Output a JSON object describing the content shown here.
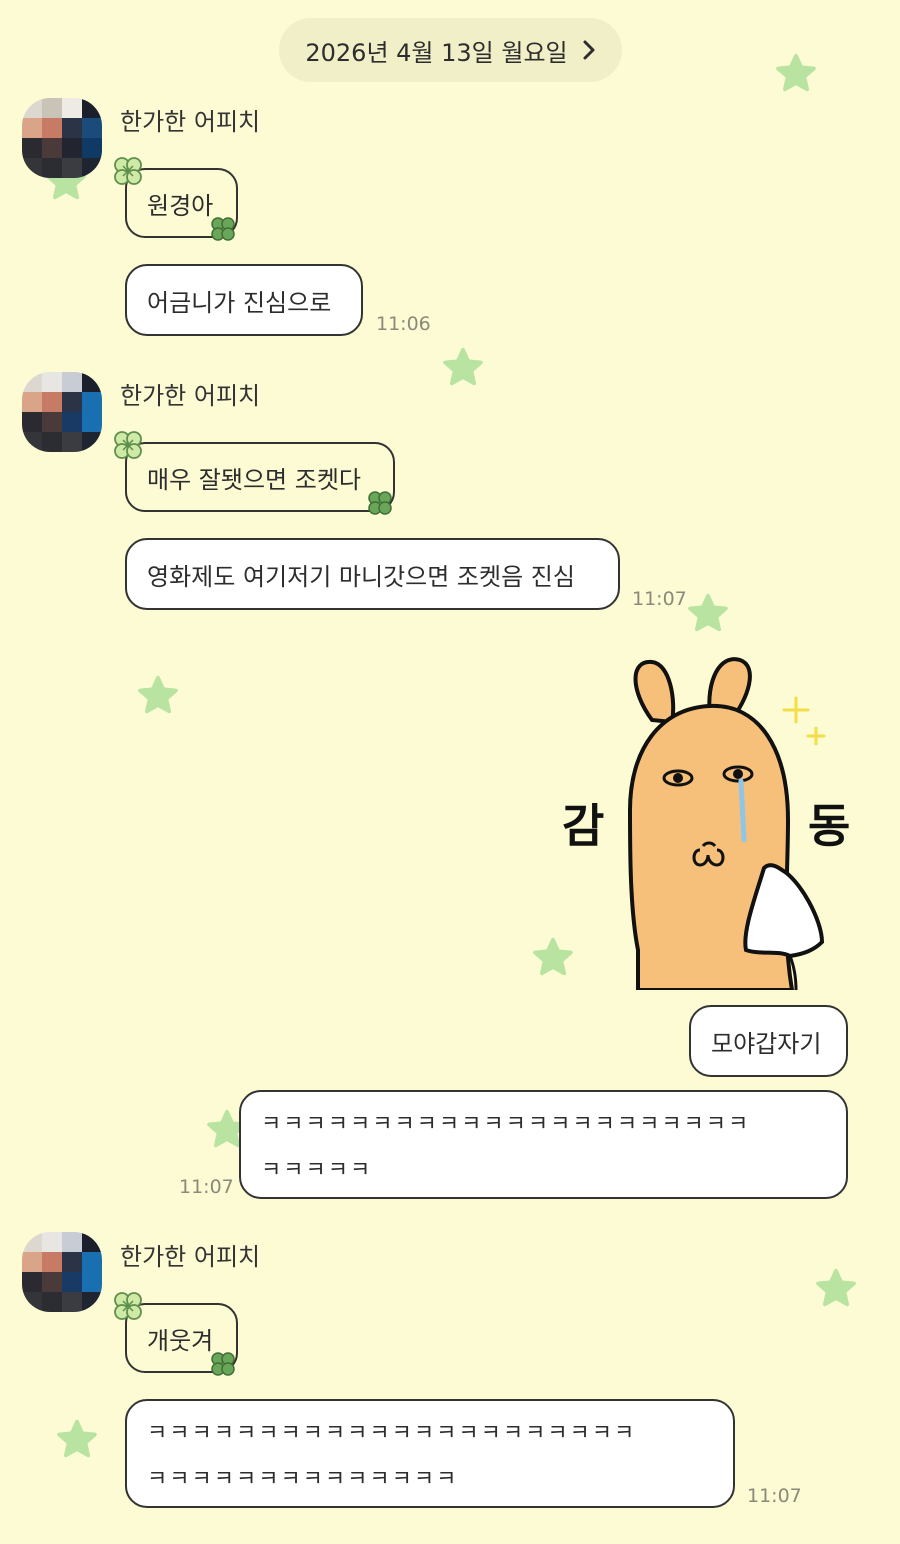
{
  "date_header": {
    "label": "2026년 4월 13일 월요일",
    "chevron_icon": "chevron-right-icon"
  },
  "colors": {
    "background": "#fcfbd4",
    "bubble": "#ffffff",
    "star": "#b9e3a0",
    "clover_light": "#cfe9a6",
    "clover_dark": "#6aa65a"
  },
  "messages": [
    {
      "sender": "한가한 어피치",
      "lines": [
        "원경아",
        "어금니가 진심으로"
      ],
      "time": "11:06"
    },
    {
      "sender": "한가한 어피치",
      "lines": [
        "매우 잘됏으면 조켓다",
        "영화제도 여기저기 마니갓으면 조켓음 진심"
      ],
      "time": "11:07"
    },
    {
      "sender": "한가한 어피치",
      "lines": [
        "개웃겨"
      ],
      "multi": [
        "ㅋㅋㅋㅋㅋㅋㅋㅋㅋㅋㅋㅋㅋㅋㅋㅋㅋㅋㅋㅋㅋㅋ",
        "ㅋㅋㅋㅋㅋㅋㅋㅋㅋㅋㅋㅋㅋㅋ"
      ],
      "time": "11:07"
    }
  ],
  "sticker": {
    "left_char": "감",
    "right_char": "동",
    "icon": "crying-rabbit-sticker-icon"
  },
  "my_messages": {
    "line1": "모야갑자기",
    "multi": [
      "ㅋㅋㅋㅋㅋㅋㅋㅋㅋㅋㅋㅋㅋㅋㅋㅋㅋㅋㅋㅋㅋㅋ",
      "ㅋㅋㅋㅋㅋ"
    ],
    "time": "11:07"
  }
}
